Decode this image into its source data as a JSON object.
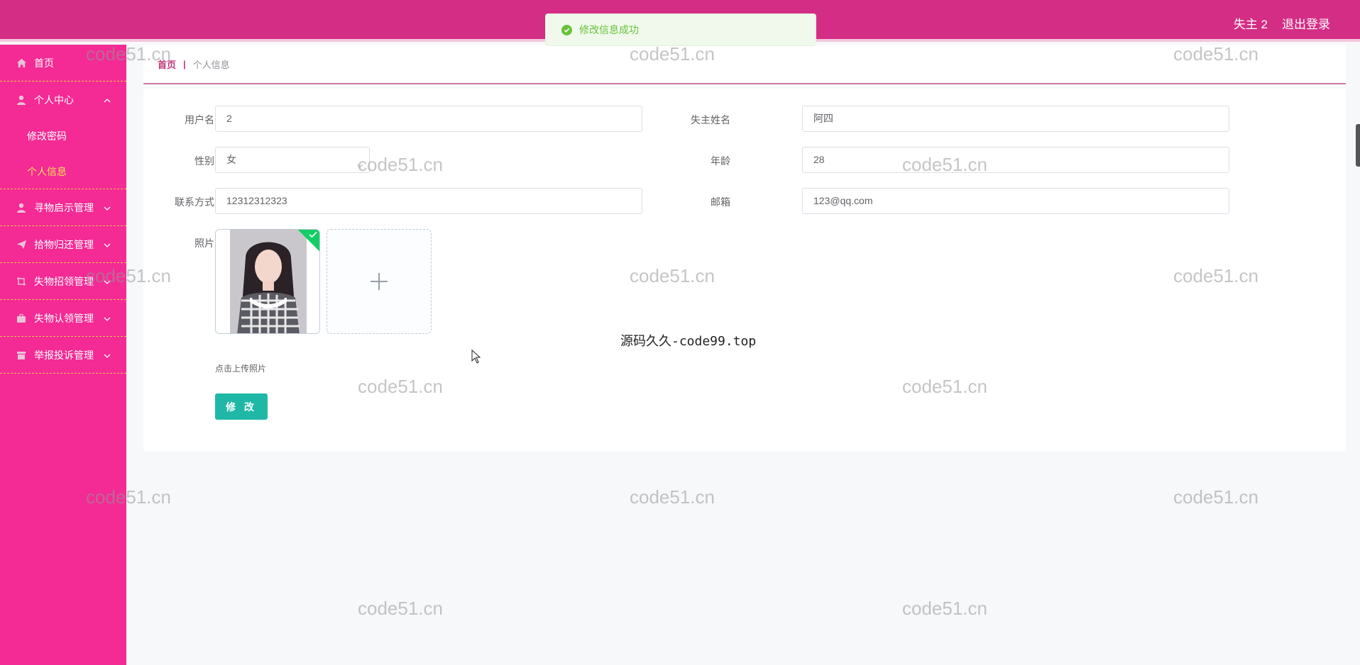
{
  "header": {
    "user": "失主 2",
    "logout": "退出登录"
  },
  "toast": {
    "message": "修改信息成功"
  },
  "sidebar": {
    "items": [
      {
        "label": "首页",
        "icon": "home-icon"
      },
      {
        "label": "个人中心",
        "icon": "user-icon",
        "open": true,
        "children": [
          {
            "label": "修改密码"
          },
          {
            "label": "个人信息",
            "active": true
          }
        ]
      },
      {
        "label": "寻物启示管理",
        "icon": "user-icon"
      },
      {
        "label": "拾物归还管理",
        "icon": "send-icon"
      },
      {
        "label": "失物招领管理",
        "icon": "crop-icon"
      },
      {
        "label": "失物认领管理",
        "icon": "suitcase-icon"
      },
      {
        "label": "举报投诉管理",
        "icon": "box-icon"
      }
    ]
  },
  "breadcrumb": {
    "home": "首页",
    "separator": "|",
    "current": "个人信息"
  },
  "form": {
    "username": {
      "label": "用户名",
      "value": "2"
    },
    "owner_name": {
      "label": "失主姓名",
      "value": "阿四"
    },
    "gender": {
      "label": "性别",
      "value": "女"
    },
    "age": {
      "label": "年龄",
      "value": "28"
    },
    "phone": {
      "label": "联系方式",
      "value": "12312312323"
    },
    "email": {
      "label": "邮箱",
      "value": "123@qq.com"
    },
    "photo": {
      "label": "照片",
      "hint": "点击上传照片"
    },
    "submit": "修 改"
  },
  "overlay_text": "源码久久-code99.top",
  "watermark": "code51.cn",
  "colors": {
    "header": "#d42d85",
    "sidebar": "#f42a95",
    "active_sub": "#f5e55a",
    "button": "#1fb8a6",
    "success": "#67c23a"
  }
}
